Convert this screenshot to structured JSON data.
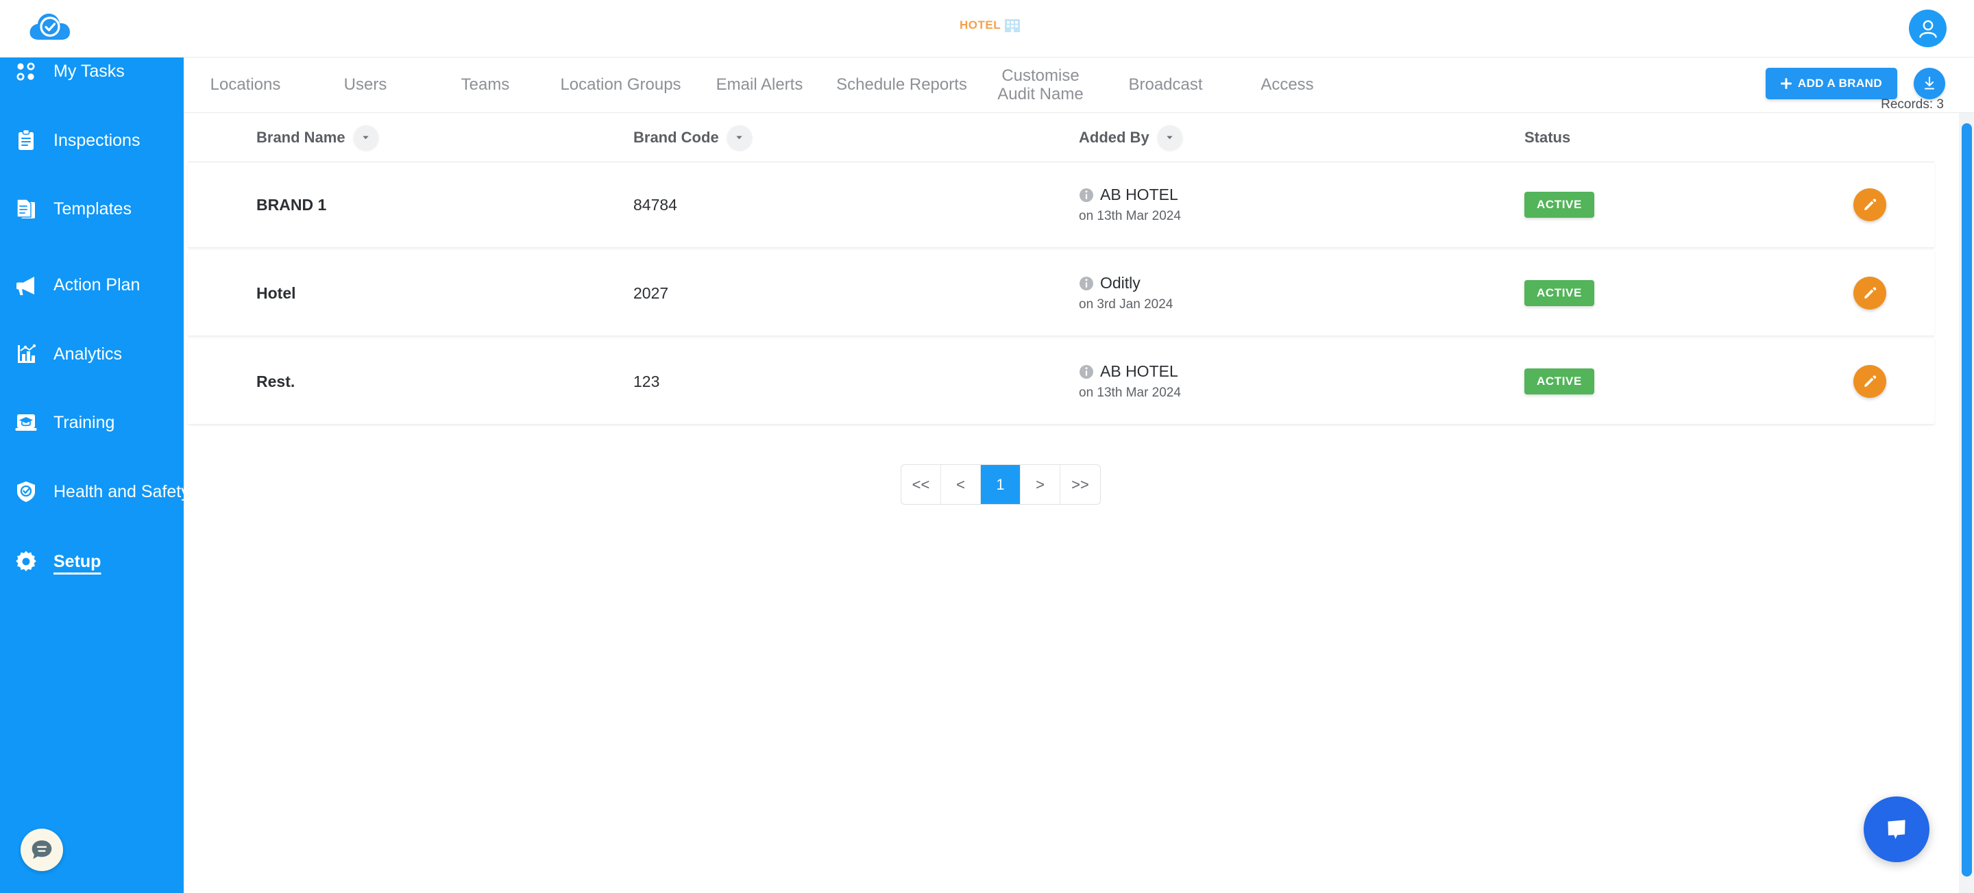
{
  "header": {
    "logo_icon": "cloud-check-icon",
    "brand_logo_text": "HOTEL",
    "brand_logo_icon": "building-icon",
    "avatar_icon": "user-avatar-icon"
  },
  "sidebar": {
    "items": [
      {
        "label": "My Tasks",
        "icon": "dots-grid-icon",
        "active": false
      },
      {
        "label": "Inspections",
        "icon": "clipboard-icon",
        "active": false
      },
      {
        "label": "Templates",
        "icon": "documents-icon",
        "active": false
      },
      {
        "label": "Action Plan",
        "icon": "megaphone-icon",
        "active": false
      },
      {
        "label": "Analytics",
        "icon": "bar-chart-icon",
        "active": false
      },
      {
        "label": "Training",
        "icon": "graduation-cap-icon",
        "active": false
      },
      {
        "label": "Health and Safety",
        "icon": "shield-check-icon",
        "active": false
      },
      {
        "label": "Setup",
        "icon": "gear-icon",
        "active": true
      }
    ],
    "help_chat_icon": "chat-bubble-icon"
  },
  "nav": {
    "tabs": [
      {
        "label": "Locations"
      },
      {
        "label": "Users"
      },
      {
        "label": "Teams"
      },
      {
        "label": "Location Groups"
      },
      {
        "label": "Email Alerts"
      },
      {
        "label": "Schedule Reports"
      },
      {
        "label": "Customise Audit Name"
      },
      {
        "label": "Broadcast"
      },
      {
        "label": "Access"
      }
    ],
    "add_brand_label": "ADD A BRAND",
    "add_brand_icon": "plus-icon",
    "download_icon": "download-icon",
    "records_label": "Records: 3"
  },
  "table": {
    "columns": [
      {
        "label": "Brand Name",
        "sortable": true
      },
      {
        "label": "Brand Code",
        "sortable": true
      },
      {
        "label": "Added By",
        "sortable": true
      },
      {
        "label": "Status",
        "sortable": false
      }
    ],
    "rows": [
      {
        "brand_name": "BRAND 1",
        "brand_code": "84784",
        "added_by": "AB HOTEL",
        "added_on": "on 13th Mar 2024",
        "status": "ACTIVE",
        "info_icon": "info-icon",
        "edit_icon": "pencil-icon"
      },
      {
        "brand_name": "Hotel",
        "brand_code": "2027",
        "added_by": "Oditly",
        "added_on": "on 3rd Jan 2024",
        "status": "ACTIVE",
        "info_icon": "info-icon",
        "edit_icon": "pencil-icon"
      },
      {
        "brand_name": "Rest.",
        "brand_code": "123",
        "added_by": "AB HOTEL",
        "added_on": "on 13th Mar 2024",
        "status": "ACTIVE",
        "info_icon": "info-icon",
        "edit_icon": "pencil-icon"
      }
    ]
  },
  "pagination": {
    "buttons": [
      {
        "label": "<<",
        "active": false
      },
      {
        "label": "<",
        "active": false
      },
      {
        "label": "1",
        "active": true
      },
      {
        "label": ">",
        "active": false
      },
      {
        "label": ">>",
        "active": false
      }
    ]
  },
  "chat_widget": {
    "icon": "chat-bubble-icon"
  },
  "colors": {
    "sidebar_blue": "#1097f7",
    "accent_blue": "#2196f3",
    "status_green": "#53b45a",
    "edit_orange": "#ed9021",
    "chat_blue": "#2268e8",
    "brand_orange": "#f6a04a"
  }
}
